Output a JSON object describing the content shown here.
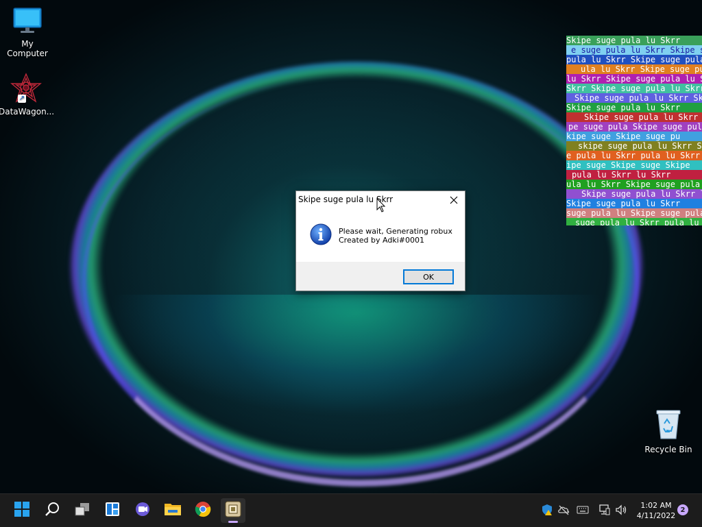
{
  "desktop": {
    "icons": [
      {
        "label": "My Computer",
        "icon": "monitor-icon"
      },
      {
        "label": "DataWagon...",
        "icon": "datawagon-app-icon"
      },
      {
        "label": "Recycle Bin",
        "icon": "recycle-bin-icon"
      }
    ]
  },
  "glitch": {
    "text": "Skipe suge pula lu Skrr",
    "strips": [
      {
        "bg": "#3aa05a",
        "fg": "#ffffff",
        "text": "Skipe suge pula lu Skrr"
      },
      {
        "bg": "#7fd0f0",
        "fg": "#1a1aa0",
        "text": "e suge pula lu Skrr Skipe suge"
      },
      {
        "bg": "#2050c0",
        "fg": "#ffffff",
        "text": "pula lu Skrr  Skipe suge pula"
      },
      {
        "bg": "#e08020",
        "fg": "#ffffff",
        "text": "ula lu Skrr Skipe suge pula lu"
      },
      {
        "bg": "#b020b0",
        "fg": "#ffffff",
        "text": "lu Skrr  Skipe suge pula lu Skrr"
      },
      {
        "bg": "#40c0a0",
        "fg": "#ffffff",
        "text": "Skrr Skipe suge pula lu Skrr"
      },
      {
        "bg": "#6060e0",
        "fg": "#ffffff",
        "text": "Skipe suge pula lu Skrr Skipe"
      },
      {
        "bg": "#20a040",
        "fg": "#ffffff",
        "text": "Skipe suge pula lu Skrr"
      },
      {
        "bg": "#c03030",
        "fg": "#ffffff",
        "text": "Skipe suge pula lu Skrr"
      },
      {
        "bg": "#a040c0",
        "fg": "#ffffff",
        "text": "pe suge pula  Skipe suge pula l"
      },
      {
        "bg": "#40a0e0",
        "fg": "#ffffff",
        "text": "kipe suge  Skipe suge pu"
      },
      {
        "bg": "#808020",
        "fg": "#ffffff",
        "text": "skipe suge pula lu Skrr Skipe"
      },
      {
        "bg": "#e06020",
        "fg": "#ffffff",
        "text": "e pula lu Skrr  pula lu Skrr"
      },
      {
        "bg": "#30c0c0",
        "fg": "#ffffff",
        "text": "ipe suge  Skipe suge  Skipe"
      },
      {
        "bg": "#c02040",
        "fg": "#ffffff",
        "text": "pula lu Skrr  lu Skrr"
      },
      {
        "bg": "#20a020",
        "fg": "#ffffff",
        "text": "ula lu Skrr Skipe suge pula lu"
      },
      {
        "bg": "#9050d0",
        "fg": "#ffffff",
        "text": "Skipe suge pula lu Skrr lu Skrr"
      },
      {
        "bg": "#2080e0",
        "fg": "#ffffff",
        "text": "Skipe suge pula lu Skrr"
      },
      {
        "bg": "#d08080",
        "fg": "#ffffff",
        "text": "suge pula lu Skipe suge pula lu"
      },
      {
        "bg": "#30b040",
        "fg": "#ffffff",
        "text": "suge pula lu Skrr  pula lu Skrr"
      }
    ]
  },
  "dialog": {
    "title": "Skipe suge pula lu Skrr",
    "line1": "Please wait, Generating robux",
    "line2": "Created by Adki#0001",
    "ok_label": "OK"
  },
  "taskbar": {
    "apps": [
      {
        "name": "start-icon"
      },
      {
        "name": "search-icon"
      },
      {
        "name": "task-view-icon"
      },
      {
        "name": "widgets-icon"
      },
      {
        "name": "teams-chat-icon"
      },
      {
        "name": "file-explorer-icon"
      },
      {
        "name": "chrome-icon"
      },
      {
        "name": "running-app-icon"
      }
    ],
    "clock_time": "1:02 AM",
    "clock_date": "4/11/2022",
    "notification_count": "2"
  }
}
